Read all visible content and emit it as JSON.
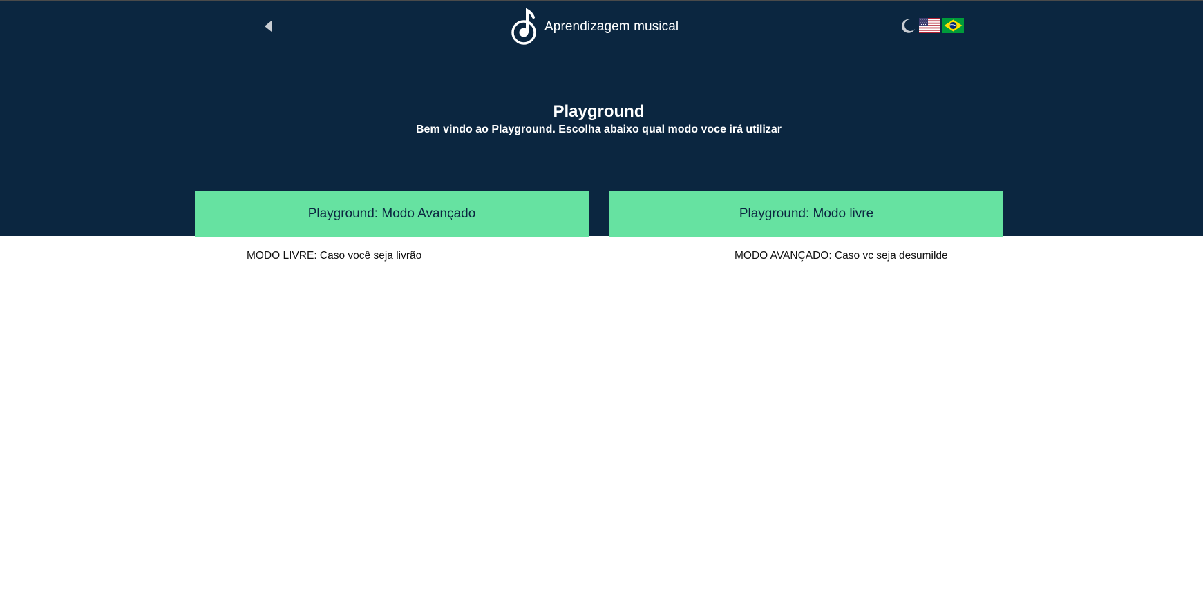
{
  "header": {
    "app_title": "Aprendizagem musical",
    "back_icon": "back-triangle-icon",
    "logo_icon": "music-note-logo-icon",
    "theme_icon": "moon-icon",
    "language_flags": [
      "us-flag-icon",
      "brazil-flag-icon"
    ]
  },
  "main": {
    "title": "Playground",
    "subtitle": "Bem vindo ao Playground. Escolha abaixo qual modo voce irá utilizar",
    "buttons": {
      "advanced_label": "Playground: Modo Avançado",
      "free_label": "Playground: Modo livre"
    },
    "descriptions": {
      "left": "MODO LIVRE: Caso você seja livrão",
      "right": "MODO AVANÇADO: Caso vc seja desumilde"
    }
  },
  "colors": {
    "hero_background": "#0b2640",
    "button_background": "#66e2a1",
    "page_background": "#ffffff"
  }
}
